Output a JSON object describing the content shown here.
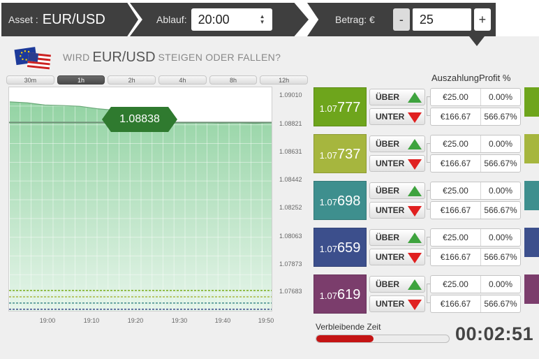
{
  "topbar": {
    "asset_label": "Asset :",
    "asset_value": "EUR/USD",
    "expiry_label": "Ablauf:",
    "expiry_value": "20:00",
    "amount_label": "Betrag: €",
    "minus_label": "-",
    "amount_value": "25",
    "plus_label": "+"
  },
  "question": {
    "prefix": "WIRD",
    "asset": "EUR/USD",
    "suffix": "STEIGEN ODER FALLEN?"
  },
  "time_tabs": [
    "30m",
    "1h",
    "2h",
    "4h",
    "8h",
    "12h"
  ],
  "active_tab": "1h",
  "current_price": "1.08838",
  "chart": {
    "y_labels": [
      "1.09010",
      "1.08821",
      "1.08631",
      "1.08442",
      "1.08252",
      "1.08063",
      "1.07873",
      "1.07683"
    ],
    "x_labels": [
      "19:00",
      "19:10",
      "19:20",
      "19:30",
      "19:40",
      "19:50"
    ],
    "fill_color": "#a5dcb3",
    "line_color": "#6aa878"
  },
  "chart_data": {
    "type": "area",
    "x": [
      "18:53",
      "18:56",
      "19:00",
      "19:04",
      "19:08",
      "19:12",
      "19:16",
      "19:20",
      "19:24",
      "19:28",
      "19:32",
      "19:36",
      "19:40",
      "19:44",
      "19:48",
      "19:51"
    ],
    "values": [
      1.08968,
      1.08962,
      1.08948,
      1.08945,
      1.0894,
      1.08925,
      1.08915,
      1.08895,
      1.0887,
      1.08842,
      1.08835,
      1.08838,
      1.08834,
      1.08836,
      1.08832,
      1.08838
    ],
    "ylim": [
      1.0764,
      1.0906
    ],
    "strike_lines": [
      1.07777,
      1.07737,
      1.07698,
      1.07659,
      1.07619
    ],
    "strike_colors": [
      "#7aab1a",
      "#a8b840",
      "#3f8a8a",
      "#3a4a8a",
      "#7a3f6a"
    ]
  },
  "payout_header": "AuszahlungProfit %",
  "options": [
    {
      "strike_pre": "1.07",
      "strike_big": "777",
      "color": "#6ea51c",
      "up_label": "ÜBER",
      "down_label": "UNTER",
      "up_amount": "€25.00",
      "up_pct": "0.00%",
      "down_amount": "€166.67",
      "down_pct": "566.67%"
    },
    {
      "strike_pre": "1.07",
      "strike_big": "737",
      "color": "#a6b63e",
      "up_label": "ÜBER",
      "down_label": "UNTER",
      "up_amount": "€25.00",
      "up_pct": "0.00%",
      "down_amount": "€166.67",
      "down_pct": "566.67%"
    },
    {
      "strike_pre": "1.07",
      "strike_big": "698",
      "color": "#3e8f8e",
      "up_label": "ÜBER",
      "down_label": "UNTER",
      "up_amount": "€25.00",
      "up_pct": "0.00%",
      "down_amount": "€166.67",
      "down_pct": "566.67%"
    },
    {
      "strike_pre": "1.07",
      "strike_big": "659",
      "color": "#3c4f8c",
      "up_label": "ÜBER",
      "down_label": "UNTER",
      "up_amount": "€25.00",
      "up_pct": "0.00%",
      "down_amount": "€166.67",
      "down_pct": "566.67%"
    },
    {
      "strike_pre": "1.07",
      "strike_big": "619",
      "color": "#7b3d6c",
      "up_label": "ÜBER",
      "down_label": "UNTER",
      "up_amount": "€25.00",
      "up_pct": "0.00%",
      "down_amount": "€166.67",
      "down_pct": "566.67%"
    }
  ],
  "remaining": {
    "label": "Verbleibende Zeit",
    "countdown": "00:02:51",
    "progress_fraction": 0.43,
    "bar_color": "#c41414"
  }
}
